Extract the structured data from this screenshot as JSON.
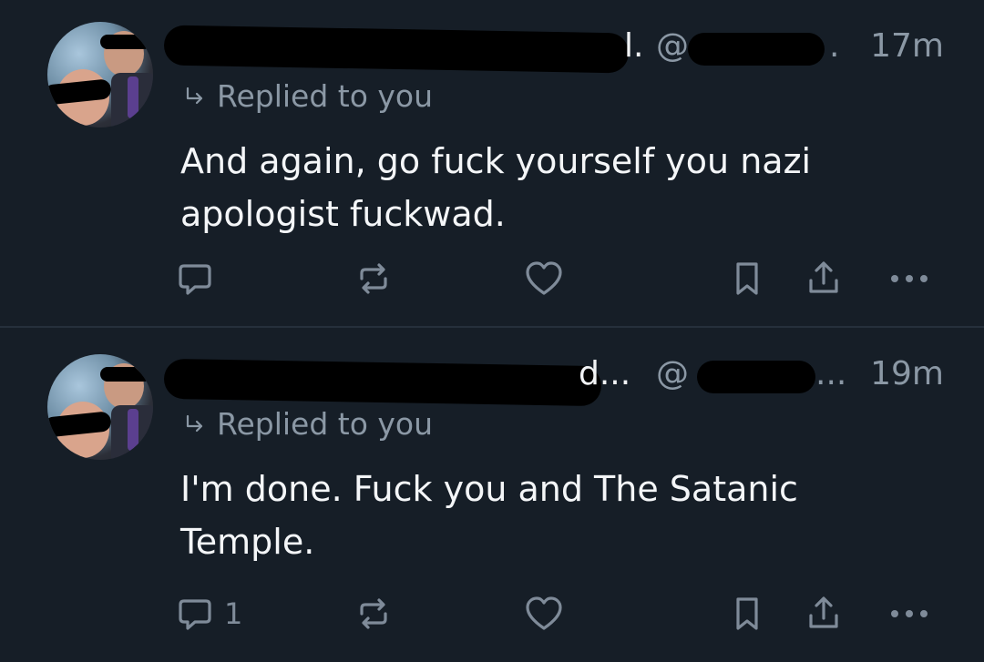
{
  "posts": [
    {
      "name_suffix": "l.",
      "handle_prefix": "@",
      "handle_suffix": ".",
      "time": "17m",
      "replied_label": "Replied to you",
      "text": "And again, go fuck yourself you nazi apologist fuckwad.",
      "reply_count": "",
      "icons": [
        "reply-icon",
        "repost-icon",
        "like-icon",
        "bookmark-icon",
        "share-icon",
        "more-icon"
      ]
    },
    {
      "name_suffix": "d...",
      "handle_prefix": "@",
      "handle_suffix": "...",
      "time": "19m",
      "replied_label": "Replied to you",
      "text": "I'm done. Fuck you and The Satanic Temple.",
      "reply_count": "1",
      "icons": [
        "reply-icon",
        "repost-icon",
        "like-icon",
        "bookmark-icon",
        "share-icon",
        "more-icon"
      ]
    }
  ],
  "colors": {
    "background": "#161e27",
    "text": "#f4f6f8",
    "muted": "#8b98a5",
    "icon": "#7f8b99",
    "divider": "#26303b"
  }
}
